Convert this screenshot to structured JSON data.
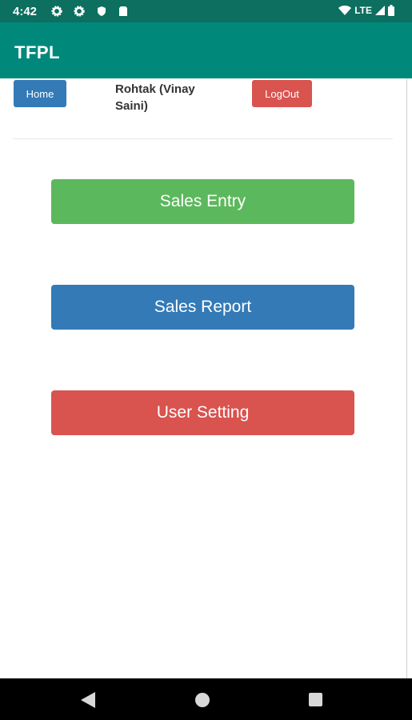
{
  "status_bar": {
    "time": "4:42",
    "network": "LTE",
    "icons": [
      "settings-icon",
      "settings-icon",
      "shield-icon",
      "sim-card-icon",
      "wifi-icon",
      "signal-icon",
      "battery-icon"
    ]
  },
  "app_bar": {
    "title": "TFPL"
  },
  "header": {
    "home_label": "Home",
    "user_label": "Rohtak (Vinay Saini)",
    "logout_label": "LogOut"
  },
  "menu": {
    "sales_entry": "Sales Entry",
    "sales_report": "Sales Report",
    "user_setting": "User Setting"
  },
  "nav_bar": {
    "icons": [
      "back-icon",
      "home-icon",
      "recents-icon"
    ]
  },
  "colors": {
    "status_bar": "#0c6f60",
    "app_bar": "#00897b",
    "primary": "#337ab7",
    "success": "#5cb85c",
    "danger": "#d9534f"
  }
}
